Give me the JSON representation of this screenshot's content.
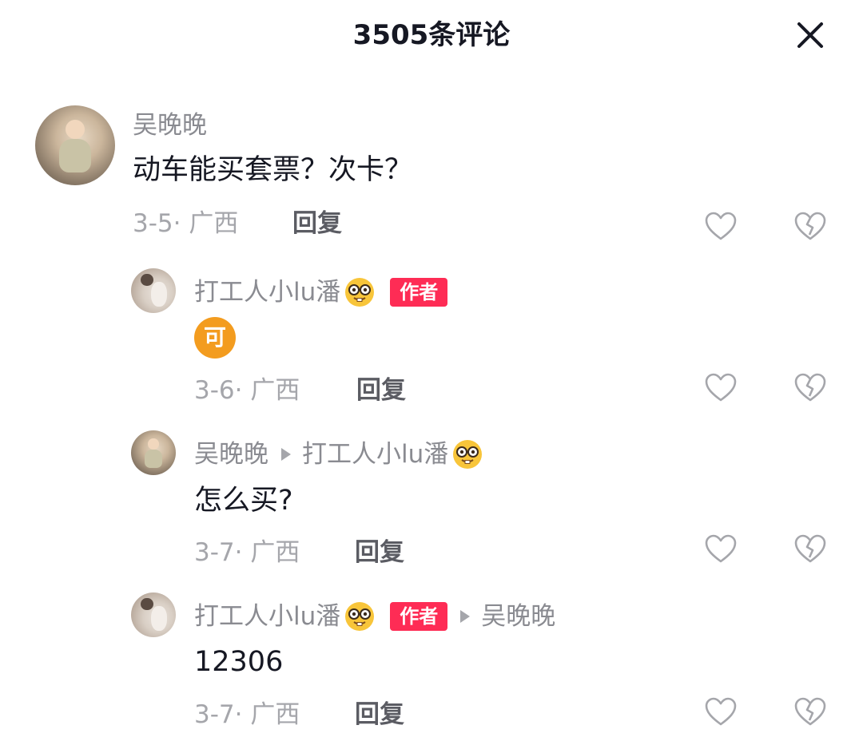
{
  "header": {
    "title": "3505条评论"
  },
  "icons": {
    "close": "close-icon",
    "like": "heart-outline-icon",
    "dislike": "broken-heart-icon",
    "emoji": "nerd-face-emoji",
    "separator": "reply-arrow-icon"
  },
  "colors": {
    "author_badge": "#fe2c55",
    "meta_gray": "#a5a6ab",
    "username_gray": "#8a8b91",
    "sticker_orange": "#f39c1f"
  },
  "comments": [
    {
      "username": "吴晚晚",
      "text": "动车能买套票？次卡？",
      "date_location": "3-5· 广西",
      "reply_label": "回复"
    },
    {
      "username": "打工人小lu潘",
      "author_badge": "作者",
      "sticker": "可",
      "date_location": "3-6· 广西",
      "reply_label": "回复"
    },
    {
      "username": "吴晚晚",
      "reply_to": "打工人小lu潘",
      "text": "怎么买?",
      "date_location": "3-7· 广西",
      "reply_label": "回复"
    },
    {
      "username": "打工人小lu潘",
      "author_badge": "作者",
      "reply_to": "吴晚晚",
      "text": "12306",
      "date_location": "3-7· 广西",
      "reply_label": "回复"
    }
  ]
}
